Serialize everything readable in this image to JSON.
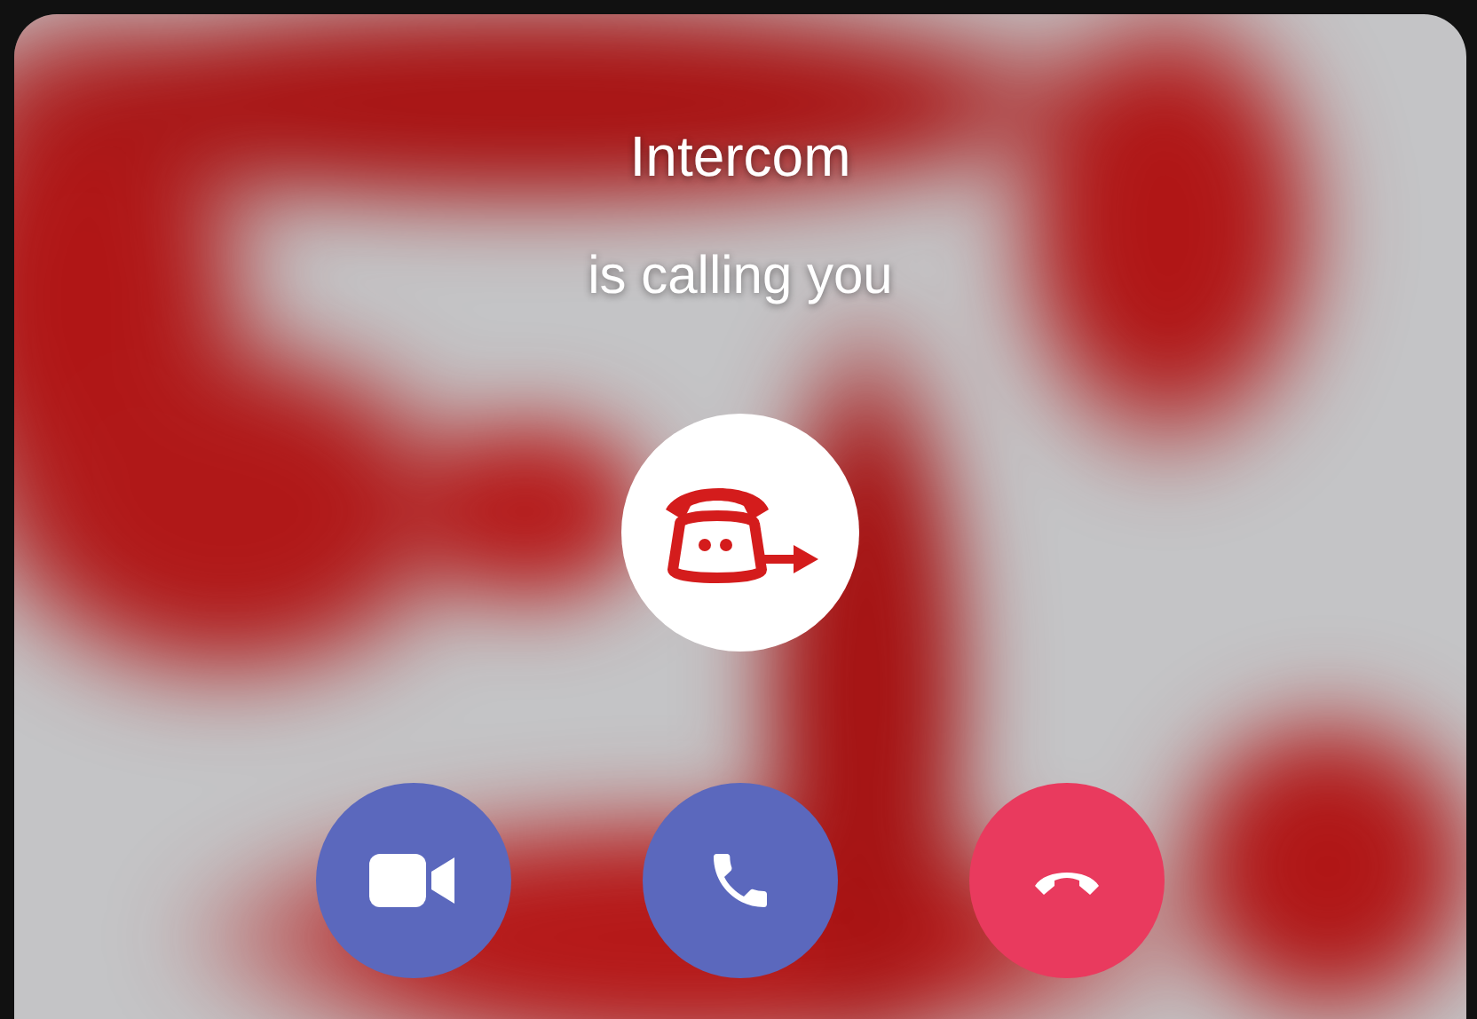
{
  "caller": {
    "name": "Intercom",
    "status": "is calling you"
  },
  "actions": [
    {
      "kind": "video"
    },
    {
      "kind": "voice"
    },
    {
      "kind": "decline"
    }
  ]
}
